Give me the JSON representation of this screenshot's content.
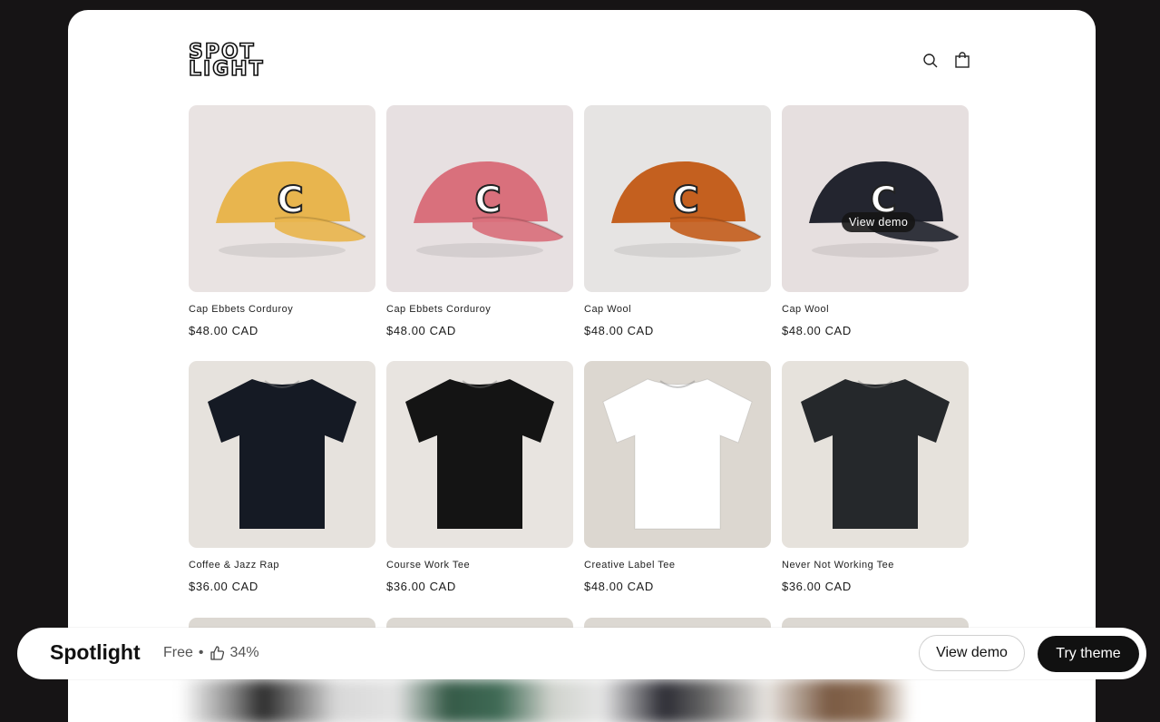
{
  "store": {
    "logo_line1": "SPOT",
    "logo_line2": "LIGHT",
    "icons": [
      "search-icon",
      "cart-icon"
    ]
  },
  "products": [
    {
      "title": "Cap Ebbets Corduroy",
      "price": "$48.00 CAD",
      "kind": "cap",
      "color": "#e8b54e",
      "bg": "#e9e3e2"
    },
    {
      "title": "Cap Ebbets Corduroy",
      "price": "$48.00 CAD",
      "kind": "cap",
      "color": "#d9707c",
      "bg": "#e7e0e1"
    },
    {
      "title": "Cap Wool",
      "price": "$48.00 CAD",
      "kind": "cap",
      "color": "#c4601f",
      "bg": "#e6e4e3"
    },
    {
      "title": "Cap Wool",
      "price": "$48.00 CAD",
      "kind": "cap",
      "color": "#23252f",
      "bg": "#e6dfdf",
      "overlay": "View demo"
    },
    {
      "title": "Coffee & Jazz Rap",
      "price": "$36.00 CAD",
      "kind": "tee",
      "color": "#151a24",
      "bg": "#e6e2dd"
    },
    {
      "title": "Course Work Tee",
      "price": "$36.00 CAD",
      "kind": "tee",
      "color": "#141414",
      "bg": "#e8e4e0"
    },
    {
      "title": "Creative Label Tee",
      "price": "$48.00 CAD",
      "kind": "tee",
      "color": "#ffffff",
      "bg": "#dcd7d0"
    },
    {
      "title": "Never Not Working Tee",
      "price": "$36.00 CAD",
      "kind": "tee",
      "color": "#25282b",
      "bg": "#e6e2dc"
    }
  ],
  "bar": {
    "name": "Spotlight",
    "price": "Free",
    "separator": "•",
    "rating": "34%",
    "view_demo": "View demo",
    "try_theme": "Try theme"
  }
}
